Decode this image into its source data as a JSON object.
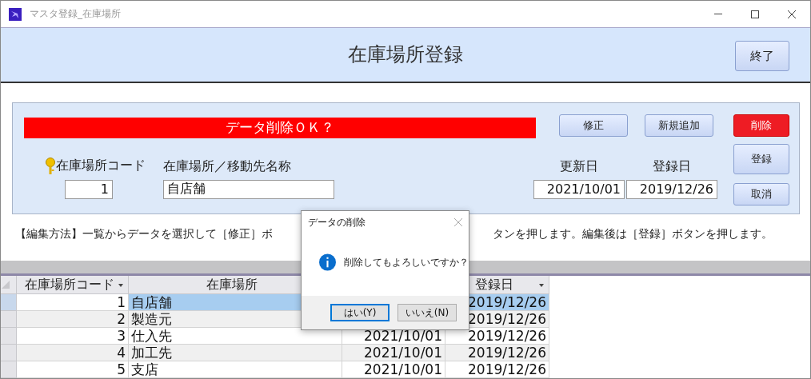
{
  "window": {
    "title": "マスタ登録_在庫場所"
  },
  "header": {
    "title": "在庫場所登録",
    "close_button": "終了"
  },
  "panel": {
    "message": "データ削除ＯＫ？",
    "top_buttons": [
      {
        "label": "修正"
      },
      {
        "label": "新規追加"
      }
    ],
    "side_buttons": [
      {
        "label": "削除",
        "kind": "danger"
      },
      {
        "label": "登録",
        "kind": "normal"
      },
      {
        "label": "取消",
        "kind": "normal"
      }
    ],
    "fields": [
      {
        "label": "在庫場所コード",
        "value": "1",
        "key": true
      },
      {
        "label": "在庫場所／移動先名称",
        "value": "自店舗",
        "key": false
      }
    ],
    "dates": [
      {
        "label": "更新日",
        "value": "2021/10/01"
      },
      {
        "label": "登録日",
        "value": "2019/12/26"
      }
    ]
  },
  "instructions": [
    "【編集方法】一覧からデータを選択して［修正］ボ",
    "タンを押します。編集後は［登録］ボタンを押します。"
  ],
  "table": {
    "columns": [
      {
        "label": "在庫場所コード",
        "menu": true
      },
      {
        "label": "在庫場所",
        "menu": false
      },
      {},
      {
        "label": "登録日",
        "menu": true
      }
    ],
    "rows": [
      {
        "selected": true,
        "cells": [
          "1",
          "自店舗",
          null,
          "2019/12/26"
        ]
      },
      {
        "selected": false,
        "cells": [
          "2",
          "製造元",
          null,
          "2019/12/26"
        ]
      },
      {
        "selected": false,
        "cells": [
          "3",
          "仕入先",
          "2021/10/01",
          "2019/12/26"
        ]
      },
      {
        "selected": false,
        "cells": [
          "4",
          "加工先",
          "2021/10/01",
          "2019/12/26"
        ]
      },
      {
        "selected": false,
        "cells": [
          "5",
          "支店",
          "2021/10/01",
          "2019/12/26"
        ]
      }
    ]
  },
  "dialog": {
    "title": "データの削除",
    "message": "削除してもよろしいですか？",
    "buttons": [
      {
        "label": "はい(Y)",
        "default": true
      },
      {
        "label": "いいえ(N)",
        "default": false
      }
    ]
  }
}
